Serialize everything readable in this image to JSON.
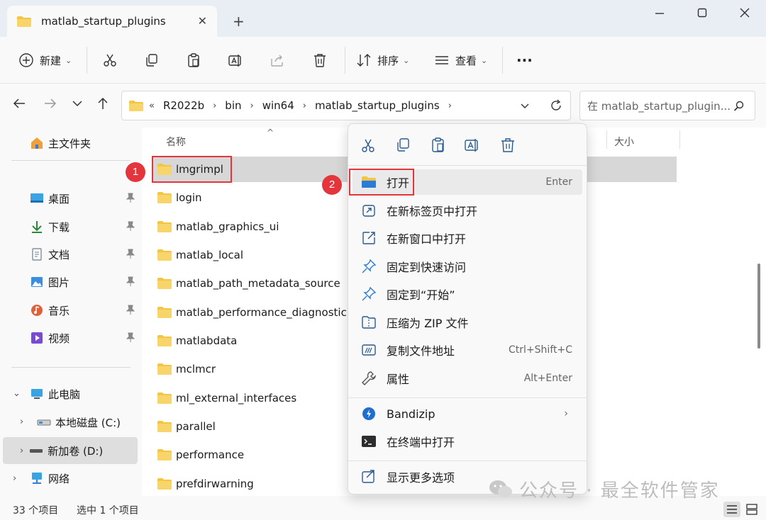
{
  "window": {
    "tab_title": "matlab_startup_plugins",
    "tab_close": "✕",
    "new_tab": "+"
  },
  "toolbar": {
    "new_label": "新建",
    "sort_label": "排序",
    "view_label": "查看",
    "more_label": "···"
  },
  "address": {
    "crumbs": [
      "R2022b",
      "bin",
      "win64",
      "matlab_startup_plugins"
    ],
    "overflow": "«",
    "search_placeholder": "在 matlab_startup_plugin..."
  },
  "sidebar": {
    "home": "主文件夹",
    "quick": [
      {
        "label": "桌面",
        "icon": "desktop-icon"
      },
      {
        "label": "下载",
        "icon": "download-icon"
      },
      {
        "label": "文档",
        "icon": "document-icon"
      },
      {
        "label": "图片",
        "icon": "pictures-icon"
      },
      {
        "label": "音乐",
        "icon": "music-icon"
      },
      {
        "label": "视频",
        "icon": "video-icon"
      }
    ],
    "this_pc": "此电脑",
    "drive_c": "本地磁盘 (C:)",
    "drive_d": "新加卷 (D:)",
    "network": "网络"
  },
  "file_list": {
    "col_name": "名称",
    "col_size": "大小",
    "files": [
      "lmgrimpl",
      "login",
      "matlab_graphics_ui",
      "matlab_local",
      "matlab_path_metadata_source",
      "matlab_performance_diagnostic",
      "matlabdata",
      "mclmcr",
      "ml_external_interfaces",
      "parallel",
      "performance",
      "prefdirwarning"
    ]
  },
  "badges": {
    "one": "1",
    "two": "2"
  },
  "context_menu": {
    "items": [
      {
        "label": "打开",
        "accel": "Enter",
        "icon": "open-folder-icon"
      },
      {
        "label": "在新标签页中打开",
        "accel": "",
        "icon": "new-tab-icon"
      },
      {
        "label": "在新窗口中打开",
        "accel": "",
        "icon": "new-window-icon"
      },
      {
        "label": "固定到快速访问",
        "accel": "",
        "icon": "pin-icon"
      },
      {
        "label": "固定到“开始”",
        "accel": "",
        "icon": "pin-start-icon"
      },
      {
        "label": "压缩为 ZIP 文件",
        "accel": "",
        "icon": "zip-icon"
      },
      {
        "label": "复制文件地址",
        "accel": "Ctrl+Shift+C",
        "icon": "copy-path-icon"
      },
      {
        "label": "属性",
        "accel": "Alt+Enter",
        "icon": "wrench-icon"
      }
    ],
    "bandizip": "Bandizip",
    "terminal": "在终端中打开",
    "more_options": "显示更多选项"
  },
  "status": {
    "count": "33 个项目",
    "selected": "选中 1 个项目"
  },
  "watermark": "公众号 · 最全软件管家",
  "colors": {
    "accent": "#e5353c",
    "folder": "#f4c542",
    "select": "#d7d7d7"
  }
}
